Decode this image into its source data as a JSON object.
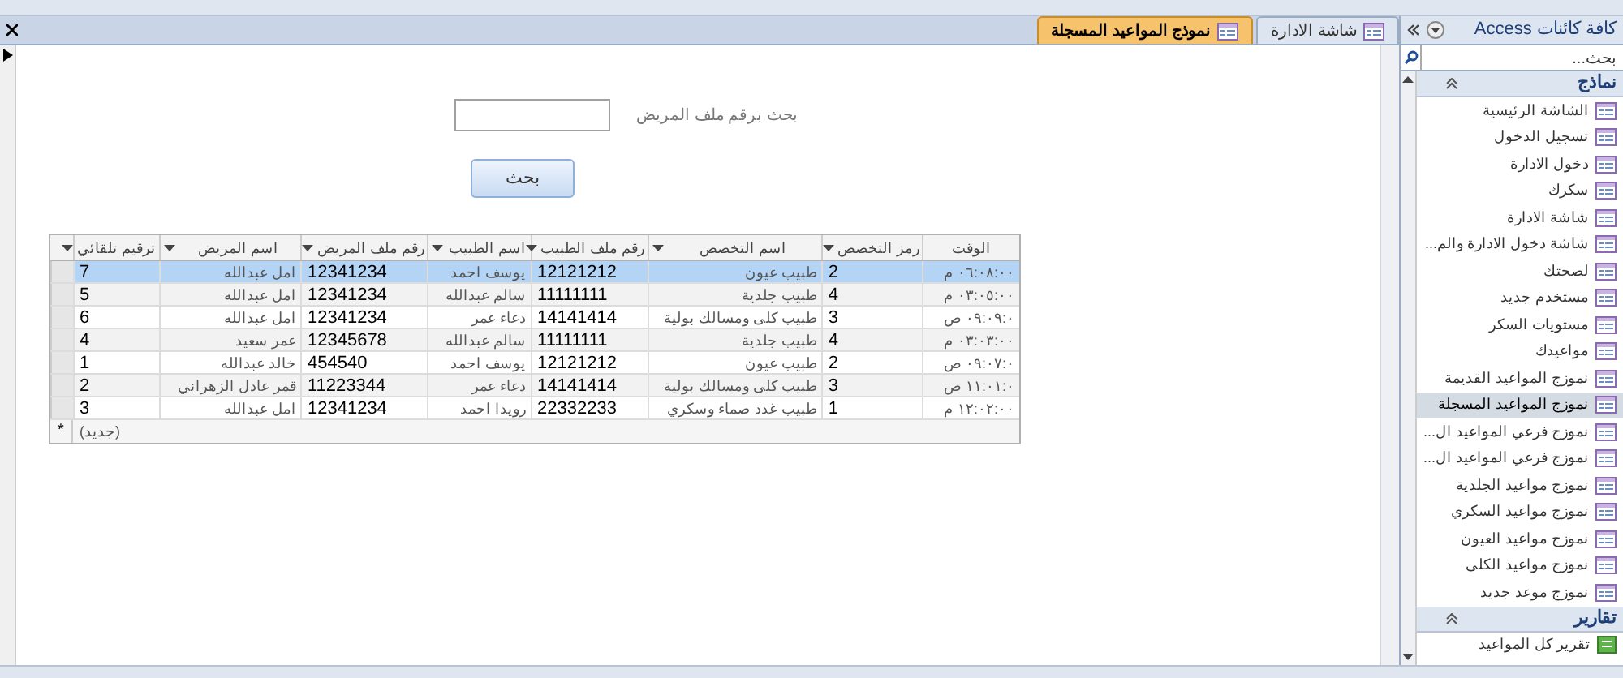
{
  "tabs": [
    {
      "label": "شاشة الادارة",
      "selected": false
    },
    {
      "label": "نموذج المواعيد المسجلة",
      "selected": true
    }
  ],
  "form": {
    "search_label": "بحث برقم ملف المريض",
    "search_button": "بحث",
    "table": {
      "columns": [
        {
          "label": "الوقت",
          "filter": false
        },
        {
          "label": "رمز التخصص",
          "filter": true
        },
        {
          "label": "اسم التخصص",
          "filter": true
        },
        {
          "label": "رقم ملف الطبيب",
          "filter": true
        },
        {
          "label": "اسم الطبيب",
          "filter": true
        },
        {
          "label": "رقم ملف المريض",
          "filter": true
        },
        {
          "label": "اسم المريض",
          "filter": true
        },
        {
          "label": "ترقيم تلقائي",
          "filter": true
        }
      ],
      "rows": [
        {
          "selected": true,
          "cells": [
            "٠٦:٠٨:٠٠ م",
            "2",
            "طبيب عيون",
            "12121212",
            "يوسف احمد",
            "12341234",
            "امل عبدالله",
            "7"
          ]
        },
        {
          "selected": false,
          "cells": [
            "٠٣:٠٥:٠٠ م",
            "4",
            "طبيب جلدية",
            "11111111",
            "سالم عبدالله",
            "12341234",
            "امل عبدالله",
            "5"
          ]
        },
        {
          "selected": false,
          "cells": [
            "٠٩:٠٩:٠ ص",
            "3",
            "طبيب كلى ومسالك بولية",
            "14141414",
            "دعاء عمر",
            "12341234",
            "امل عبدالله",
            "6"
          ]
        },
        {
          "selected": false,
          "cells": [
            "٠٣:٠٣:٠٠ م",
            "4",
            "طبيب جلدية",
            "11111111",
            "سالم عبدالله",
            "12345678",
            "عمر سعيد",
            "4"
          ]
        },
        {
          "selected": false,
          "cells": [
            "٠٩:٠٧:٠ ص",
            "2",
            "طبيب عيون",
            "12121212",
            "يوسف احمد",
            "454540",
            "خالد عبدالله",
            "1"
          ]
        },
        {
          "selected": false,
          "cells": [
            "١١:٠١:٠ ص",
            "3",
            "طبيب كلى ومسالك بولية",
            "14141414",
            "دعاء عمر",
            "11223344",
            "قمر عادل الزهراني",
            "2"
          ]
        },
        {
          "selected": false,
          "cells": [
            "١٢:٠٢:٠٠ م",
            "1",
            "طبيب غدد صماء وسكري",
            "22332233",
            "رويدا احمد",
            "12341234",
            "امل عبدالله",
            "3"
          ]
        }
      ],
      "new_row_marker": "*",
      "new_row_label": "(جديد)"
    }
  },
  "nav": {
    "title": "كافة كائنات Access",
    "search_placeholder": "بحث...",
    "groups": [
      {
        "title": "نماذج",
        "expanded": true,
        "kind": "form",
        "items": [
          {
            "label": "الشاشة الرئيسية",
            "selected": false
          },
          {
            "label": "تسجيل الدخول",
            "selected": false
          },
          {
            "label": "دخول الادارة",
            "selected": false
          },
          {
            "label": "سكرك",
            "selected": false
          },
          {
            "label": "شاشة الادارة",
            "selected": false
          },
          {
            "label": "شاشة دخول الادارة والم...",
            "selected": false
          },
          {
            "label": "لصحتك",
            "selected": false
          },
          {
            "label": "مستخدم جديد",
            "selected": false
          },
          {
            "label": "مستويات السكر",
            "selected": false
          },
          {
            "label": "مواعيدك",
            "selected": false
          },
          {
            "label": "نموزج المواعيد القديمة",
            "selected": false
          },
          {
            "label": "نموزج المواعيد المسجلة",
            "selected": true
          },
          {
            "label": "نموزج فرعي المواعيد ال...",
            "selected": false
          },
          {
            "label": "نموزج فرعي المواعيد ال...",
            "selected": false
          },
          {
            "label": "نموزج مواعيد الجلدية",
            "selected": false
          },
          {
            "label": "نموزج مواعيد السكري",
            "selected": false
          },
          {
            "label": "نموزج مواعيد العيون",
            "selected": false
          },
          {
            "label": "نموزج مواعيد الكلى",
            "selected": false
          },
          {
            "label": "نموزج موعد جديد",
            "selected": false
          }
        ]
      },
      {
        "title": "تقارير",
        "expanded": true,
        "kind": "report",
        "items": [
          {
            "label": "تقرير كل المواعيد",
            "selected": false
          }
        ]
      }
    ]
  }
}
